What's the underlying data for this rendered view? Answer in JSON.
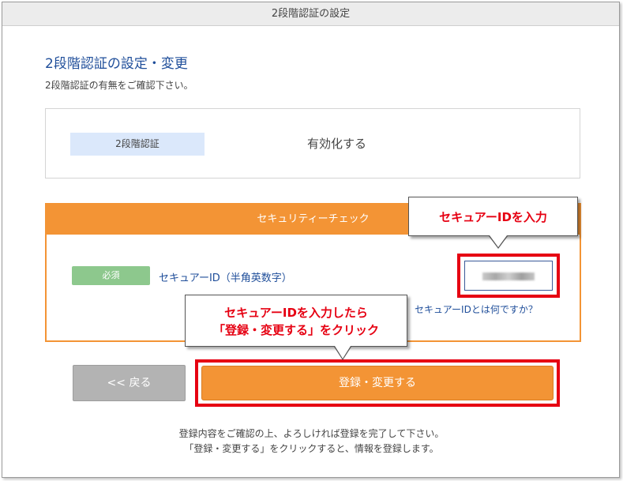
{
  "window": {
    "title": "2段階認証の設定"
  },
  "section": {
    "title": "2段階認証の設定・変更",
    "subtitle": "2段階認証の有無をご確認下さい。"
  },
  "twofa": {
    "label": "2段階認証",
    "value": "有効化する"
  },
  "security": {
    "header": "セキュリティーチェック",
    "required_badge": "必須",
    "field_label": "セキュアーID（半角英数字）",
    "help_link": "セキュアーIDとは何ですか？"
  },
  "buttons": {
    "back": "<< 戻る",
    "submit": "登録・変更する"
  },
  "notes": {
    "line1": "登録内容をご確認の上、よろしければ登録を完了して下さい。",
    "line2": "「登録・変更する」をクリックすると、情報を登録します。"
  },
  "callouts": {
    "input_hint": "セキュアーIDを入力",
    "submit_hint_line1": "セキュアーIDを入力したら",
    "submit_hint_line2": "「登録・変更する」をクリック"
  },
  "colors": {
    "accent_orange": "#f39435",
    "highlight_red": "#e60012",
    "required_green": "#8dc88d",
    "label_blue_bg": "#dbe8fb",
    "text_blue": "#1f4e9a"
  }
}
